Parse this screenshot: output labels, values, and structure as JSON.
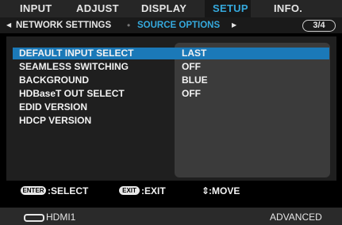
{
  "menu": {
    "tabs": [
      {
        "label": "INPUT"
      },
      {
        "label": "ADJUST"
      },
      {
        "label": "DISPLAY"
      },
      {
        "label": "SETUP"
      },
      {
        "label": "INFO."
      }
    ],
    "active_tab": "SETUP"
  },
  "submenu": {
    "items": [
      "NETWORK SETTINGS",
      "SOURCE OPTIONS"
    ],
    "active": "SOURCE OPTIONS",
    "page": "3/4"
  },
  "settings": [
    {
      "label": "DEFAULT INPUT SELECT",
      "value": "LAST",
      "selected": true
    },
    {
      "label": "SEAMLESS SWITCHING",
      "value": "OFF"
    },
    {
      "label": "BACKGROUND",
      "value": "BLUE"
    },
    {
      "label": "HDBaseT OUT SELECT",
      "value": "OFF"
    },
    {
      "label": "EDID VERSION",
      "value": ""
    },
    {
      "label": "HDCP VERSION",
      "value": ""
    }
  ],
  "footer": {
    "enter_key": "ENTER",
    "enter_action": ":SELECT",
    "exit_key": "EXIT",
    "exit_action": ":EXIT",
    "move_action": ":MOVE",
    "move_glyph": "⇕"
  },
  "status": {
    "input": "HDMI1",
    "mode": "ADVANCED"
  },
  "colors": {
    "accent": "#35a9dd",
    "selection": "#1b79b8"
  }
}
